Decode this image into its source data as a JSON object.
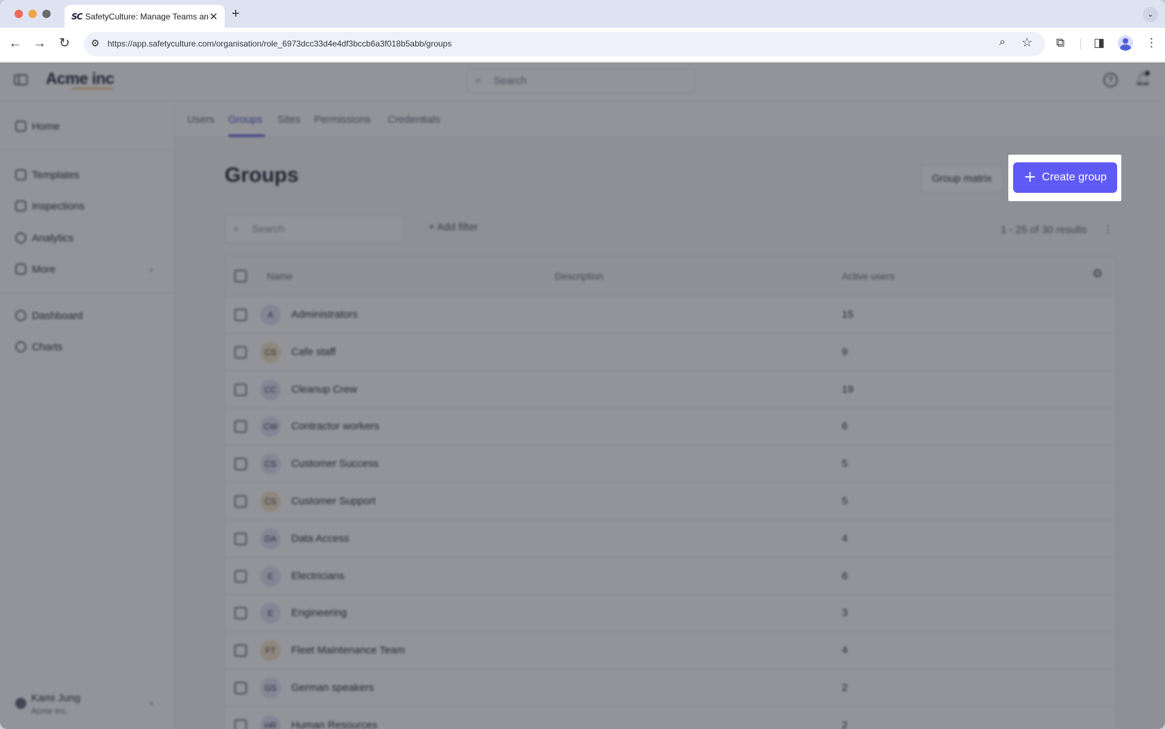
{
  "browser": {
    "tab_title": "SafetyCulture: Manage Teams and...",
    "favicon": "SC",
    "tab_close": "✕",
    "new_tab": "+",
    "url": "https://app.safetyculture.com/organisation/role_6973dcc33d4e4df3bccb6a3f018b5abb/groups"
  },
  "app": {
    "brand": "Acme inc",
    "search_placeholder": "Search"
  },
  "sidebar": {
    "items": [
      {
        "label": "Home"
      },
      {
        "label": "Templates"
      },
      {
        "label": "Inspections"
      },
      {
        "label": "Analytics"
      },
      {
        "label": "More"
      },
      {
        "label": "Dashboard"
      },
      {
        "label": "Charts"
      }
    ],
    "user": {
      "name": "Kami Jung",
      "org": "Acme Inc."
    }
  },
  "subnav": {
    "tabs": [
      {
        "label": "Users"
      },
      {
        "label": "Groups",
        "active": true
      },
      {
        "label": "Sites"
      },
      {
        "label": "Permissions"
      },
      {
        "label": "Credentials"
      }
    ]
  },
  "page": {
    "title": "Groups",
    "group_matrix_label": "Group matrix",
    "create_group_label": "Create group",
    "search_placeholder": "Search",
    "add_filter_label": "Add filter",
    "results_text": "1 - 25 of 30 results"
  },
  "table": {
    "headers": {
      "name": "Name",
      "description": "Description",
      "active_users": "Active users"
    },
    "rows": [
      {
        "initials": "A",
        "name": "Administrators",
        "active_users": "15",
        "color": "#dfe3f7"
      },
      {
        "initials": "CS",
        "name": "Cafe staff",
        "active_users": "9",
        "color": "#f6e3c7"
      },
      {
        "initials": "CC",
        "name": "Cleanup Crew",
        "active_users": "19",
        "color": "#dfe3f7"
      },
      {
        "initials": "CW",
        "name": "Contractor workers",
        "active_users": "6",
        "color": "#dfe3f7"
      },
      {
        "initials": "CS",
        "name": "Customer Success",
        "active_users": "5",
        "color": "#dfe3f7"
      },
      {
        "initials": "CS",
        "name": "Customer Support",
        "active_users": "5",
        "color": "#f6e3c7"
      },
      {
        "initials": "DA",
        "name": "Data Access",
        "active_users": "4",
        "color": "#dfe3f7"
      },
      {
        "initials": "E",
        "name": "Electricians",
        "active_users": "6",
        "color": "#dfe3f7"
      },
      {
        "initials": "E",
        "name": "Engineering",
        "active_users": "3",
        "color": "#dfe3f7"
      },
      {
        "initials": "FT",
        "name": "Fleet Maintenance Team",
        "active_users": "4",
        "color": "#f6e3c7"
      },
      {
        "initials": "GS",
        "name": "German speakers",
        "active_users": "2",
        "color": "#dfe3f7"
      },
      {
        "initials": "HR",
        "name": "Human Resources",
        "active_users": "2",
        "color": "#dfe3f7"
      }
    ]
  },
  "colors": {
    "accent": "#5f5af6",
    "overlay": "rgba(40,42,52,0.5)"
  }
}
